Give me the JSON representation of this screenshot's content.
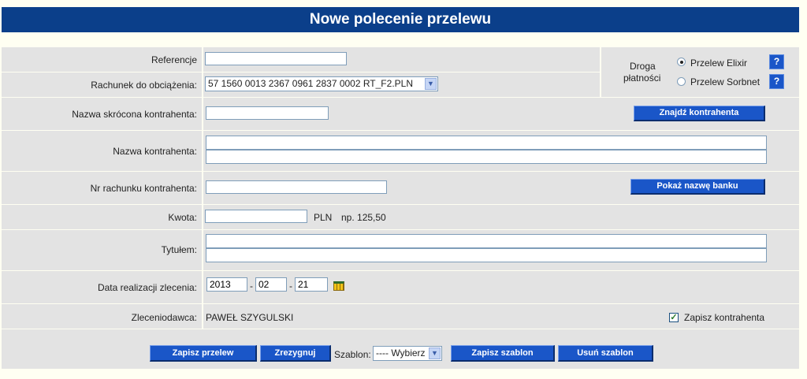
{
  "title": "Nowe polecenie przelewu",
  "fields": {
    "referencje": {
      "label": "Referencje",
      "value": ""
    },
    "rachunek": {
      "label": "Rachunek do obciążenia:",
      "value": "57 1560 0013 2367 0961 2837 0002  RT_F2.PLN"
    },
    "nazwa_skrocona": {
      "label": "Nazwa skrócona kontrahenta:",
      "value": ""
    },
    "nazwa": {
      "label": "Nazwa kontrahenta:",
      "value_line1": "",
      "value_line2": ""
    },
    "nr_rachunku": {
      "label": "Nr rachunku kontrahenta:",
      "value": ""
    },
    "kwota": {
      "label": "Kwota:",
      "value": "",
      "currency": "PLN",
      "hint": "np. 125,50"
    },
    "tytulem": {
      "label": "Tytułem:",
      "value_line1": "",
      "value_line2": ""
    },
    "data": {
      "label": "Data realizacji zlecenia:",
      "year": "2013",
      "month": "02",
      "day": "21",
      "sep": "-"
    },
    "zleceniodawca": {
      "label": "Zleceniodawca:",
      "value": "PAWEŁ SZYGULSKI"
    }
  },
  "droga": {
    "label_line1": "Droga",
    "label_line2": "płatności",
    "options": [
      {
        "label": "Przelew Elixir",
        "selected": true
      },
      {
        "label": "Przelew Sorbnet",
        "selected": false
      }
    ],
    "help": "?"
  },
  "buttons": {
    "find": "Znajdź kontrahenta",
    "show_bank": "Pokaż nazwę banku",
    "save_transfer": "Zapisz przelew",
    "cancel": "Zrezygnuj",
    "save_template": "Zapisz szablon",
    "delete_template": "Usuń szablon"
  },
  "save_contractor": {
    "label": "Zapisz kontrahenta",
    "checked": true
  },
  "template": {
    "label": "Szablon:",
    "selected": "---- Wybierz"
  },
  "colors": {
    "header": "#0b3f8a",
    "button": "#1a56c8",
    "panel": "#e3e3e3"
  }
}
